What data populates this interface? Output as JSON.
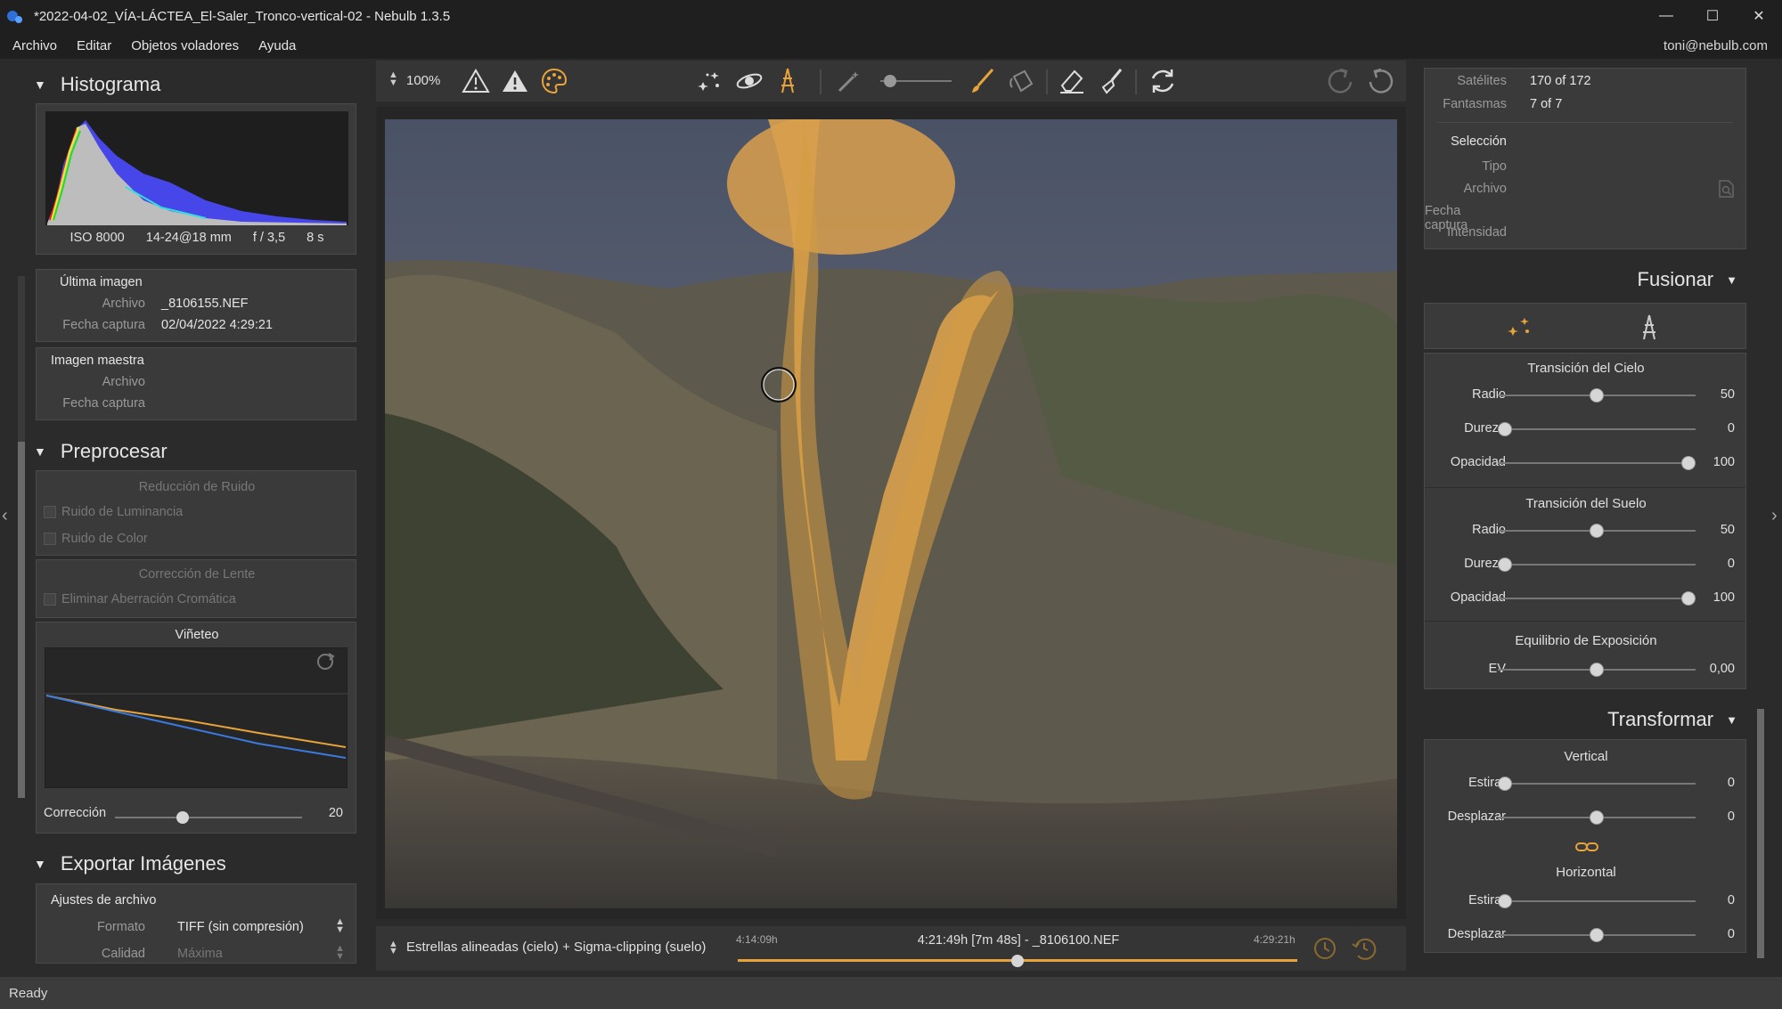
{
  "window": {
    "title": "*2022-04-02_VÍA-LÁCTEA_El-Saler_Tronco-vertical-02 - Nebulb 1.3.5"
  },
  "menu": {
    "items": [
      "Archivo",
      "Editar",
      "Objetos voladores",
      "Ayuda"
    ],
    "user": "toni@nebulb.com"
  },
  "left": {
    "histogram": {
      "title": "Histograma",
      "iso": "ISO 8000",
      "lens": "14-24@18 mm",
      "aperture": "f / 3,5",
      "exposure": "8 s"
    },
    "last_image": {
      "title": "Última imagen",
      "file_label": "Archivo",
      "file": "_8106155.NEF",
      "date_label": "Fecha captura",
      "date": "02/04/2022 4:29:21"
    },
    "master_image": {
      "title": "Imagen maestra",
      "file_label": "Archivo",
      "date_label": "Fecha captura"
    },
    "preprocess": {
      "title": "Preprocesar",
      "noise_title": "Reducción de Ruido",
      "luminance_noise": "Ruido de Luminancia",
      "color_noise": "Ruido de Color",
      "lens_title": "Corrección de Lente",
      "chromatic": "Eliminar Aberración Cromática",
      "vignette_title": "Viñeteo",
      "correction_label": "Corrección",
      "correction_value": "20",
      "correction_level": 0.35
    },
    "export": {
      "title": "Exportar Imágenes",
      "file_settings": "Ajustes de archivo",
      "format_label": "Formato",
      "format_value": "TIFF (sin compresión)",
      "quality_label": "Calidad",
      "quality_value": "Máxima"
    }
  },
  "toolbar": {
    "zoom": "100%"
  },
  "bottom": {
    "mode": "Estrellas alineadas (cielo) + Sigma-clipping (suelo)",
    "time_start": "4:14:09h",
    "time_current": "4:21:49h [7m 48s] - _8106100.NEF",
    "time_end": "4:29:21h",
    "timeline_position": 0.5
  },
  "right": {
    "satellites_label": "Satélites",
    "satellites_value": "170 of 172",
    "ghosts_label": "Fantasmas",
    "ghosts_value": "7 of 7",
    "selection_title": "Selección",
    "type_label": "Tipo",
    "file_label": "Archivo",
    "date_label": "Fecha captura",
    "intensity_label": "Intensidad",
    "fusion": {
      "title": "Fusionar",
      "sky_title": "Transición del Cielo",
      "ground_title": "Transición del Suelo",
      "exposure_title": "Equilibrio de Exposición",
      "radius_label": "Radio",
      "hardness_label": "Dureza",
      "opacity_label": "Opacidad",
      "ev_label": "EV",
      "sky_radius": "50",
      "sky_hardness": "0",
      "sky_opacity": "100",
      "ground_radius": "50",
      "ground_hardness": "0",
      "ground_opacity": "100",
      "ev_value": "0,00"
    },
    "transform": {
      "title": "Transformar",
      "vertical_title": "Vertical",
      "horizontal_title": "Horizontal",
      "stretch_label": "Estirar",
      "shift_label": "Desplazar",
      "v_stretch": "0",
      "v_shift": "0",
      "h_stretch": "0",
      "h_shift": "0"
    }
  },
  "status": {
    "text": "Ready"
  },
  "colors": {
    "accent": "#e8a33a",
    "panel": "#3a3a3a",
    "background": "#2b2b2b",
    "mask": "#d9a04c"
  }
}
